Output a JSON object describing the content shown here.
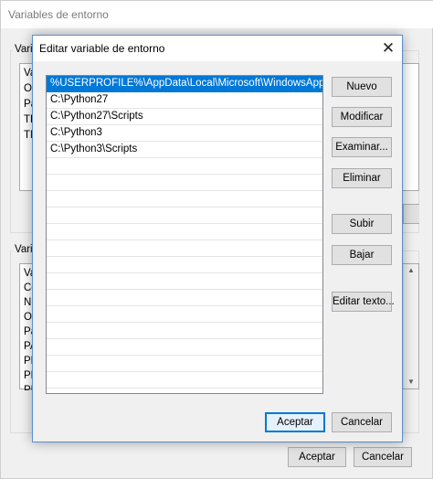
{
  "background_window": {
    "title": "Variables de entorno",
    "group1_label": "Varia",
    "list1_items": [
      "Va",
      "On",
      "Pa",
      "TE",
      "TM"
    ],
    "group2_label": "Varia",
    "list2_items": [
      "Va",
      "Co",
      "NU",
      "OS",
      "Pa",
      "PA",
      "PR",
      "PR",
      "PR"
    ],
    "ok_label": "Aceptar",
    "cancel_label": "Cancelar"
  },
  "dialog": {
    "title": "Editar variable de entorno",
    "close_glyph": "✕",
    "paths": [
      "%USERPROFILE%\\AppData\\Local\\Microsoft\\WindowsApps",
      "C:\\Python27",
      "C:\\Python27\\Scripts",
      "C:\\Python3",
      "C:\\Python3\\Scripts"
    ],
    "selected_index": 0,
    "buttons": {
      "new": "Nuevo",
      "edit": "Modificar",
      "browse": "Examinar...",
      "delete": "Eliminar",
      "up": "Subir",
      "down": "Bajar",
      "edit_text": "Editar texto..."
    },
    "ok_label": "Aceptar",
    "cancel_label": "Cancelar"
  },
  "colors": {
    "selection": "#0078d7",
    "dialog_border": "#5a8fd0",
    "button_face": "#e1e1e1"
  }
}
